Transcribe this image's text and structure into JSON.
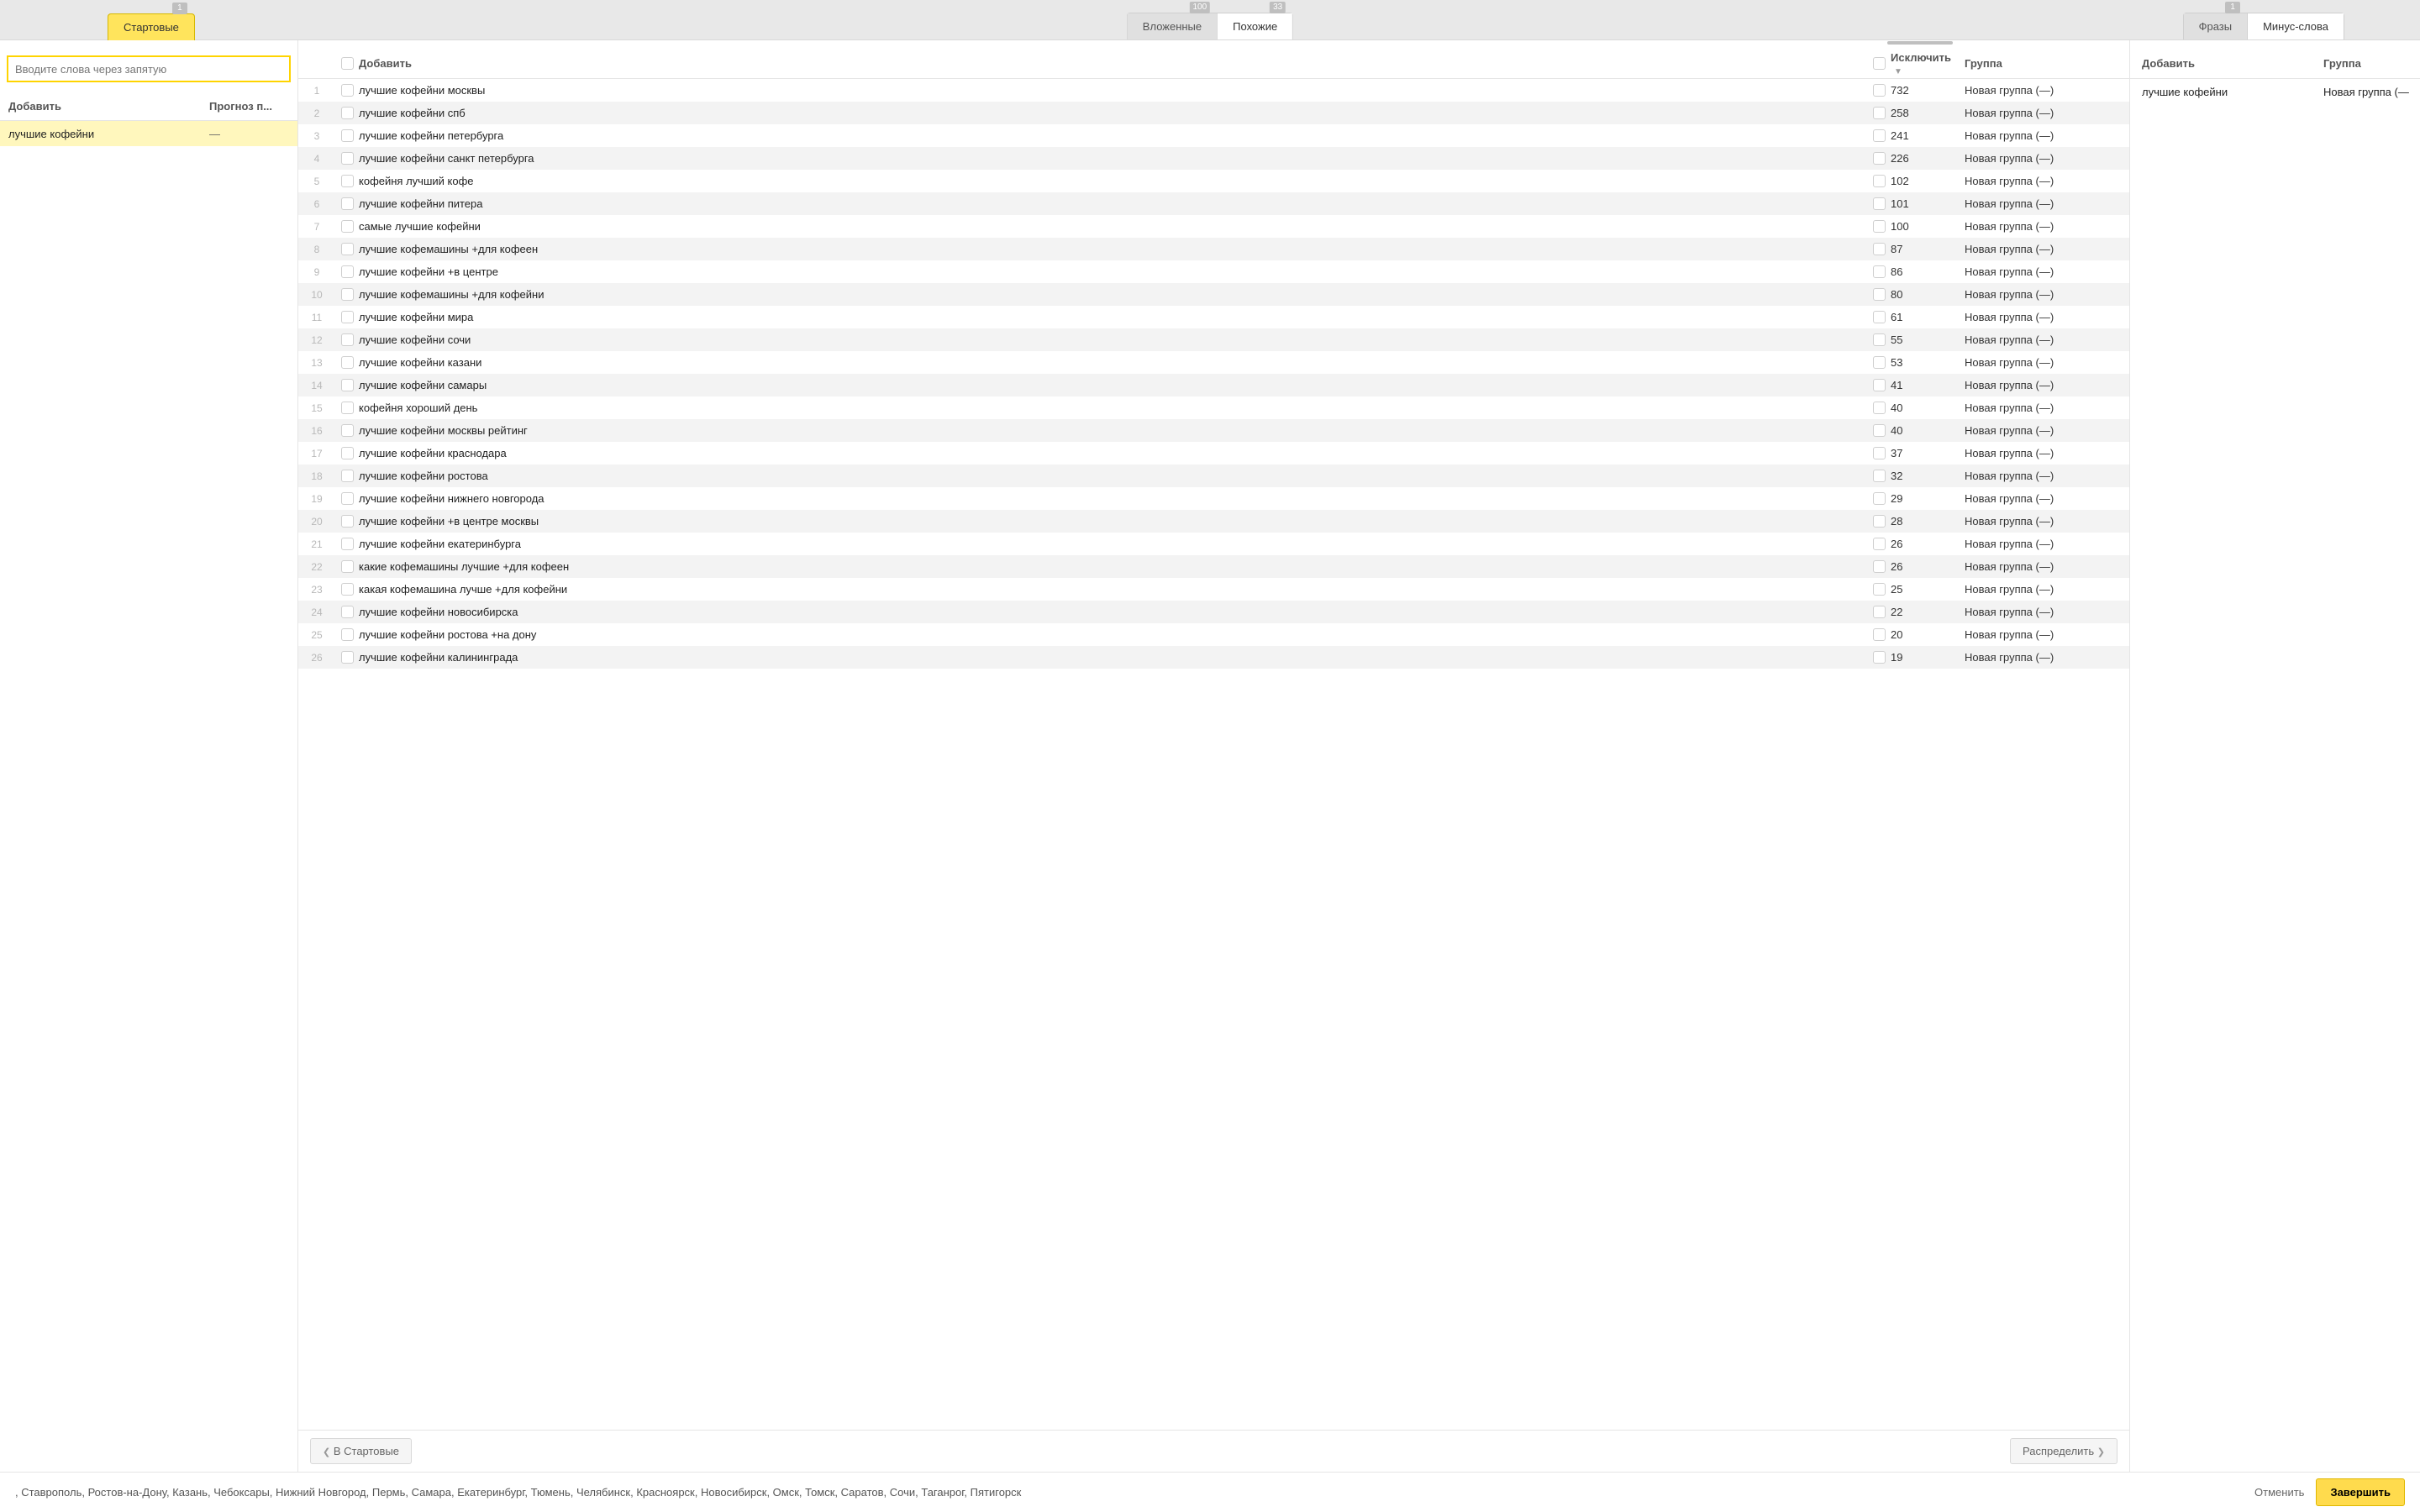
{
  "top": {
    "left_tab": {
      "label": "Стартовые",
      "badge": "1"
    },
    "center_tabs": {
      "nested": {
        "label": "Вложенные",
        "badge": "100"
      },
      "similar": {
        "label": "Похожие",
        "badge": "33"
      }
    },
    "right_tabs": {
      "phrases": {
        "label": "Фразы",
        "badge": "1"
      },
      "minus": {
        "label": "Минус-слова"
      }
    }
  },
  "left": {
    "placeholder": "Вводите слова через запятую",
    "head_add": "Добавить",
    "head_forecast": "Прогноз п...",
    "seed_phrase": "лучшие кофейни",
    "seed_forecast": "—"
  },
  "mid": {
    "head_add": "Добавить",
    "head_exclude": "Исключить",
    "head_group": "Группа",
    "group_label": "Новая группа (—)",
    "rows": [
      {
        "n": 1,
        "phrase": "лучшие кофейни москвы",
        "count": 732
      },
      {
        "n": 2,
        "phrase": "лучшие кофейни спб",
        "count": 258
      },
      {
        "n": 3,
        "phrase": "лучшие кофейни петербурга",
        "count": 241
      },
      {
        "n": 4,
        "phrase": "лучшие кофейни санкт петербурга",
        "count": 226
      },
      {
        "n": 5,
        "phrase": "кофейня лучший кофе",
        "count": 102
      },
      {
        "n": 6,
        "phrase": "лучшие кофейни питера",
        "count": 101
      },
      {
        "n": 7,
        "phrase": "самые лучшие кофейни",
        "count": 100
      },
      {
        "n": 8,
        "phrase": "лучшие кофемашины +для кофеен",
        "count": 87
      },
      {
        "n": 9,
        "phrase": "лучшие кофейни +в центре",
        "count": 86
      },
      {
        "n": 10,
        "phrase": "лучшие кофемашины +для кофейни",
        "count": 80
      },
      {
        "n": 11,
        "phrase": "лучшие кофейни мира",
        "count": 61
      },
      {
        "n": 12,
        "phrase": "лучшие кофейни сочи",
        "count": 55
      },
      {
        "n": 13,
        "phrase": "лучшие кофейни казани",
        "count": 53
      },
      {
        "n": 14,
        "phrase": "лучшие кофейни самары",
        "count": 41
      },
      {
        "n": 15,
        "phrase": "кофейня хороший день",
        "count": 40
      },
      {
        "n": 16,
        "phrase": "лучшие кофейни москвы рейтинг",
        "count": 40
      },
      {
        "n": 17,
        "phrase": "лучшие кофейни краснодара",
        "count": 37
      },
      {
        "n": 18,
        "phrase": "лучшие кофейни ростова",
        "count": 32
      },
      {
        "n": 19,
        "phrase": "лучшие кофейни нижнего новгорода",
        "count": 29
      },
      {
        "n": 20,
        "phrase": "лучшие кофейни +в центре москвы",
        "count": 28
      },
      {
        "n": 21,
        "phrase": "лучшие кофейни екатеринбурга",
        "count": 26
      },
      {
        "n": 22,
        "phrase": "какие кофемашины лучшие +для кофеен",
        "count": 26
      },
      {
        "n": 23,
        "phrase": "какая кофемашина лучше +для кофейни",
        "count": 25
      },
      {
        "n": 24,
        "phrase": "лучшие кофейни новосибирска",
        "count": 22
      },
      {
        "n": 25,
        "phrase": "лучшие кофейни ростова +на дону",
        "count": 20
      },
      {
        "n": 26,
        "phrase": "лучшие кофейни калининграда",
        "count": 19
      }
    ],
    "back_btn": "В Стартовые",
    "dist_btn": "Распределить"
  },
  "right": {
    "head_add": "Добавить",
    "head_group": "Группа",
    "row_phrase": "лучшие кофейни",
    "row_group": "Новая группа (—"
  },
  "footer": {
    "regions": ", Ставрополь, Ростов-на-Дону, Казань, Чебоксары, Нижний Новгород, Пермь, Самара, Екатеринбург, Тюмень, Челябинск, Красноярск, Новосибирск, Омск, Томск, Саратов, Сочи, Таганрог, Пятигорск",
    "cancel": "Отменить",
    "finish": "Завершить"
  }
}
